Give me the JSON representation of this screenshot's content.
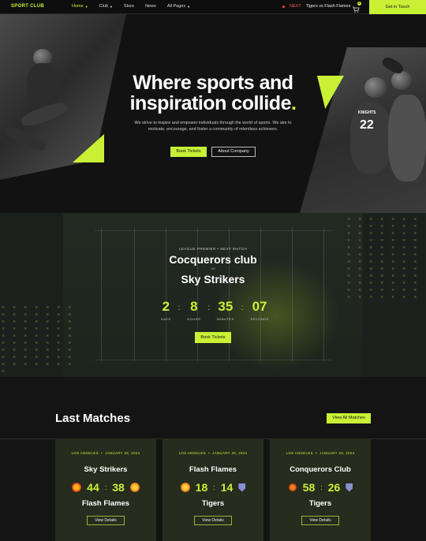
{
  "nav": {
    "logo": "SPORT CLUB",
    "menu": [
      {
        "label": "Home",
        "has_dropdown": true,
        "active": true
      },
      {
        "label": "Club",
        "has_dropdown": true,
        "active": false
      },
      {
        "label": "Store",
        "has_dropdown": false,
        "active": false
      },
      {
        "label": "News",
        "has_dropdown": false,
        "active": false
      },
      {
        "label": "All Pages",
        "has_dropdown": true,
        "active": false
      }
    ],
    "next_label": "NEXT",
    "next_match": "Tigers vs Flash Flames",
    "cart_count": "0",
    "cta": "Get in Touch"
  },
  "hero": {
    "title_line1": "Where sports and",
    "title_line2": "inspiration collide",
    "title_dot": ".",
    "subtitle": "We strive to inspire and empower individuals through the world of sports. We aim to motivate, encourage, and foster a community of relentless achievers.",
    "btn_primary": "Book Tickets",
    "btn_secondary": "About Company",
    "jersey_number": "22",
    "jersey_text": "KNIGHTS"
  },
  "next_match": {
    "league": "LEAGUE PREMIER • NEXT MATCH",
    "team1": "Cocquerors club",
    "vs": "VS",
    "team2": "Sky Strikers",
    "countdown": [
      {
        "value": "2",
        "label": "DAYS"
      },
      {
        "value": "8",
        "label": "HOURS"
      },
      {
        "value": "35",
        "label": "MINUTES"
      },
      {
        "value": "07",
        "label": "SECONDS"
      }
    ],
    "btn": "Book Tickets"
  },
  "last_matches": {
    "title": "Last Matches",
    "btn_all": "View All Matches",
    "cards": [
      {
        "city": "LOS ANGELES",
        "date": "JANUARY 28, 2024",
        "team1": "Sky Strikers",
        "score1": "44",
        "score2": "38",
        "team2": "Flash Flames",
        "btn": "View Details"
      },
      {
        "city": "LOS ANGELES",
        "date": "JANUARY 28, 2024",
        "team1": "Flash Flames",
        "score1": "18",
        "score2": "14",
        "team2": "Tigers",
        "btn": "View Details"
      },
      {
        "city": "LOS ANGELES",
        "date": "JANUARY 28, 2024",
        "team1": "Conquerors Club",
        "score1": "58",
        "score2": "26",
        "team2": "Tigers",
        "btn": "View Details"
      }
    ]
  },
  "colors": {
    "accent": "#c8f135",
    "bg": "#141414",
    "live": "#ff4040"
  }
}
